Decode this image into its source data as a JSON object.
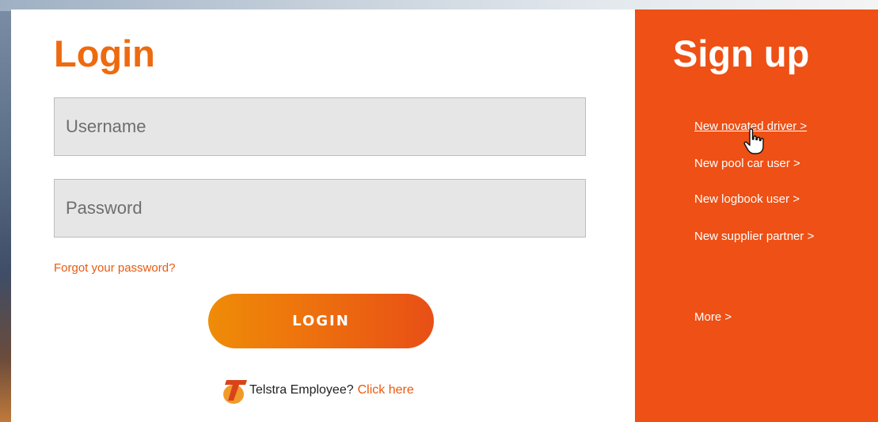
{
  "login": {
    "title": "Login",
    "username_placeholder": "Username",
    "password_placeholder": "Password",
    "forgot_link": "Forgot your password?",
    "button_label": "LOGIN",
    "telstra_text": "Telstra Employee?",
    "telstra_link": "Click here"
  },
  "signup": {
    "title": "Sign up",
    "links": [
      "New novated driver >",
      "New pool car user >",
      "New logbook user >",
      "New supplier partner >"
    ],
    "more_link": "More >"
  },
  "colors": {
    "accent_orange": "#ee6a0e",
    "signup_panel": "#ee5015",
    "field_bg": "#e6e6e6"
  },
  "icons": [
    "telstra-logo-icon",
    "hand-pointer-icon"
  ]
}
